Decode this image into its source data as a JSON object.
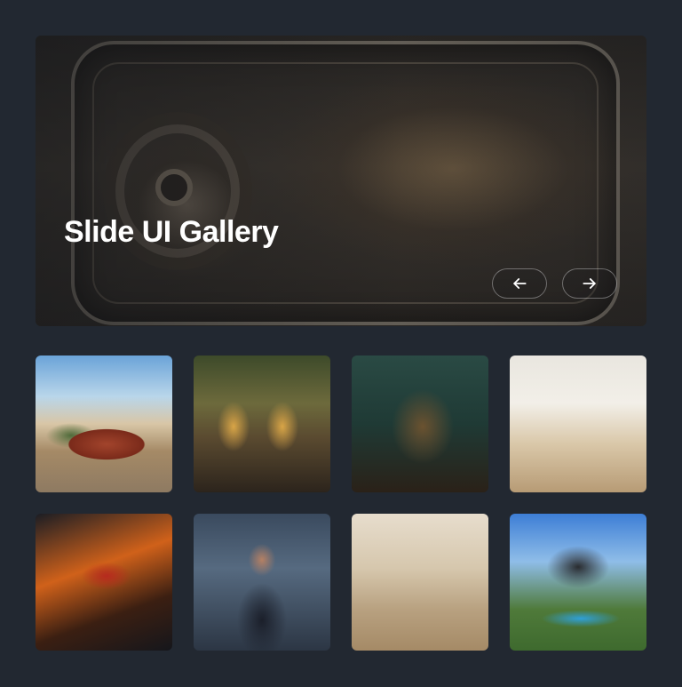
{
  "hero": {
    "title": "Slide UI Gallery",
    "prev_icon": "arrow-left-icon",
    "next_icon": "arrow-right-icon"
  },
  "gallery": {
    "items": [
      {
        "subject": "classic-cars-street"
      },
      {
        "subject": "cooks-in-kitchen"
      },
      {
        "subject": "birdcage-with-dog"
      },
      {
        "subject": "bright-office-interior"
      },
      {
        "subject": "truck-at-speed"
      },
      {
        "subject": "businesswoman-portrait"
      },
      {
        "subject": "modern-lounge-interior"
      },
      {
        "subject": "house-with-pool"
      }
    ]
  },
  "colors": {
    "background": "#222831",
    "text": "#ffffff"
  }
}
